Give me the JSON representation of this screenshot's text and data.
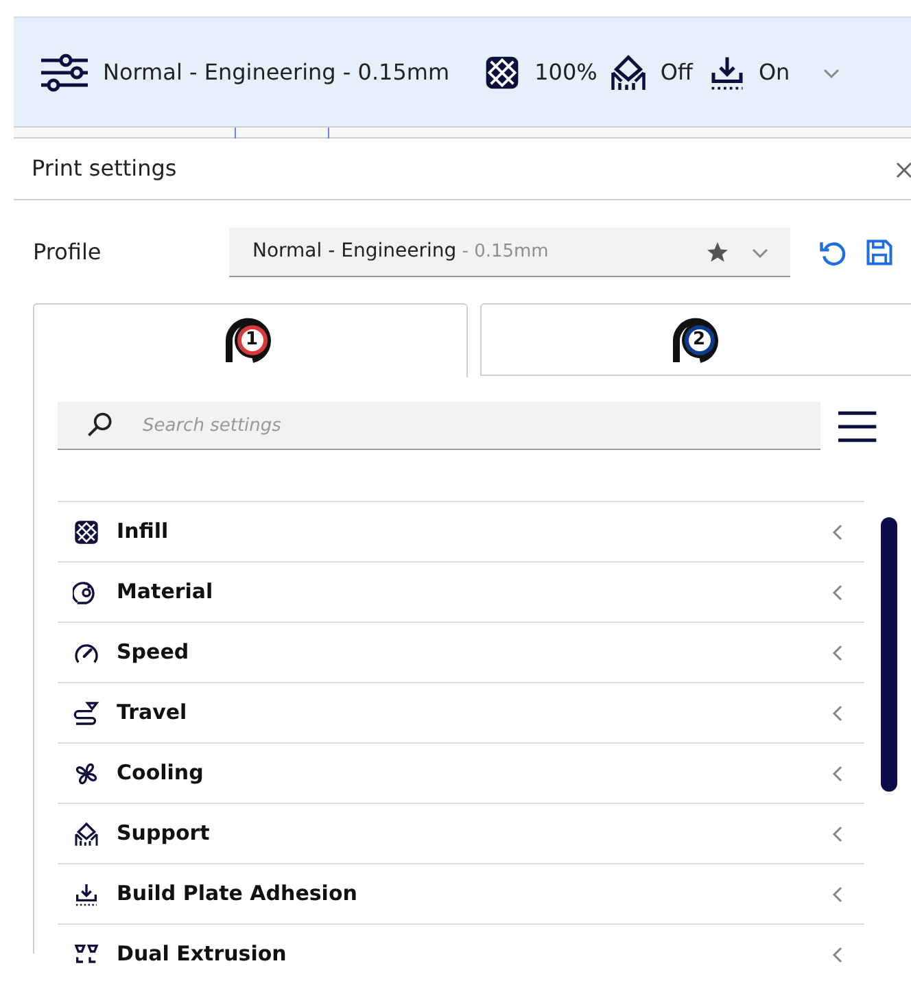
{
  "top_bar": {
    "profile": "Normal - Engineering - 0.15mm",
    "infill": "100%",
    "support": "Off",
    "adhesion": "On"
  },
  "panel": {
    "title": "Print settings"
  },
  "profile": {
    "label": "Profile",
    "name": "Normal - Engineering",
    "suffix": " - 0.15mm"
  },
  "tabs": [
    {
      "label": "1",
      "color": "#d63a3a",
      "selected": true
    },
    {
      "label": "2",
      "color": "#0e3b8c",
      "selected": false
    }
  ],
  "search": {
    "placeholder": "Search settings"
  },
  "categories": [
    {
      "kind": "infill",
      "label": "Infill"
    },
    {
      "kind": "material",
      "label": "Material"
    },
    {
      "kind": "speed",
      "label": "Speed"
    },
    {
      "kind": "travel",
      "label": "Travel"
    },
    {
      "kind": "cooling",
      "label": "Cooling"
    },
    {
      "kind": "support",
      "label": "Support"
    },
    {
      "kind": "adhesion",
      "label": "Build Plate Adhesion"
    },
    {
      "kind": "dual",
      "label": "Dual Extrusion"
    }
  ]
}
